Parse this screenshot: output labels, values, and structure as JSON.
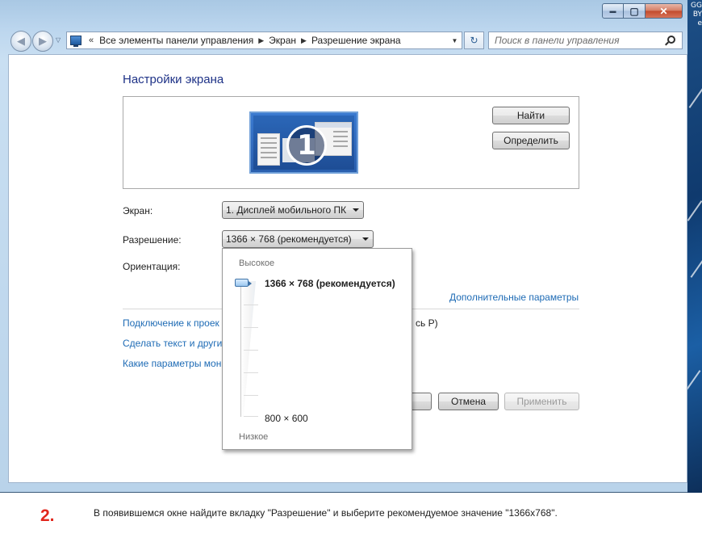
{
  "window": {
    "caption": {
      "minimize": "▬",
      "maximize": "▢",
      "close": "✕"
    },
    "desktop_text": "GG\nBY\ne"
  },
  "nav": {
    "back": "◀",
    "forward": "▶",
    "recent": "▽",
    "breadcrumb": [
      "Все элементы панели управления",
      "Экран",
      "Разрешение экрана"
    ],
    "chevron": "«",
    "separator": "▶",
    "dropdown": "▼",
    "refresh": "↻",
    "search_placeholder": "Поиск в панели управления"
  },
  "main": {
    "title": "Настройки экрана",
    "monitor_number": "1",
    "find_button": "Найти",
    "identify_button": "Определить",
    "screen_label": "Экран:",
    "screen_value": "1. Дисплей мобильного ПК",
    "resolution_label": "Разрешение:",
    "resolution_value": "1366 × 768 (рекомендуется)",
    "orientation_label": "Ориентация:",
    "advanced_link": "Дополнительные параметры",
    "links": {
      "projector": "Подключение к проек",
      "projector_tail": "сь P)",
      "text_size": "Сделать текст и други",
      "which_params": "Какие параметры мон"
    },
    "cancel_button": "Отмена",
    "apply_button": "Применить"
  },
  "resolution_popup": {
    "high_label": "Высокое",
    "low_label": "Низкое",
    "current": "1366 × 768 (рекомендуется)",
    "minimum": "800 × 600",
    "slider_level": 1.0
  },
  "instruction": {
    "step": "2.",
    "text": "В появившемся окне найдите вкладку \"Разрешение\" и выберите рекомендуемое значение \"1366x768\"."
  }
}
